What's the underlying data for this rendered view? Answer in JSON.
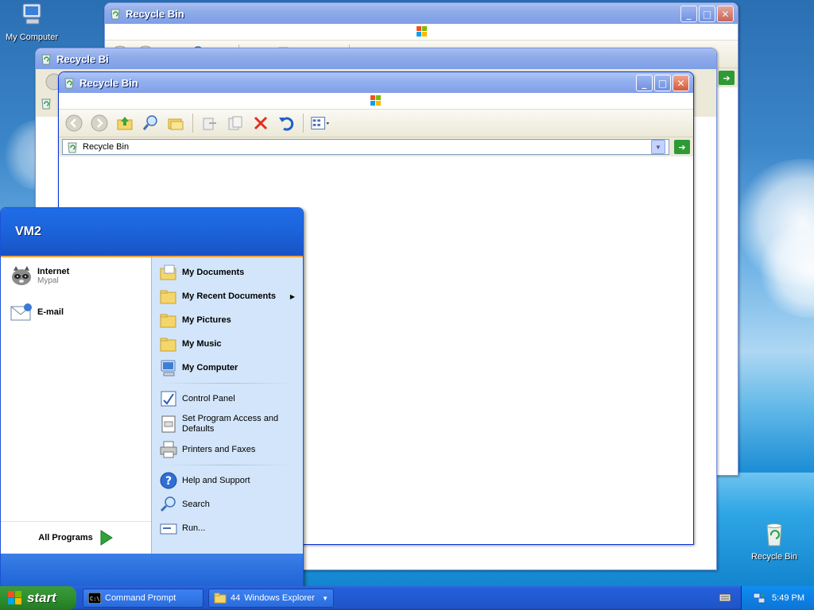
{
  "desktop": {
    "icons": [
      {
        "label": "My Computer"
      },
      {
        "label": "Recycle Bin"
      }
    ]
  },
  "windows": {
    "back": {
      "title": "Recycle Bin"
    },
    "middle": {
      "title": "Recycle Bi"
    },
    "front": {
      "title": "Recycle Bin",
      "address": "Recycle Bin"
    }
  },
  "start_menu": {
    "user": "VM2",
    "pinned": [
      {
        "label": "Internet",
        "sub": "Mypal"
      },
      {
        "label": "E-mail"
      }
    ],
    "all_programs": "All Programs",
    "right": {
      "my_documents": "My Documents",
      "my_recent_documents": "My Recent Documents",
      "my_pictures": "My Pictures",
      "my_music": "My Music",
      "my_computer": "My Computer",
      "control_panel": "Control Panel",
      "set_program_access_1": "Set Program Access and",
      "set_program_access_2": "Defaults",
      "printers": "Printers and Faxes",
      "help": "Help and Support",
      "search": "Search",
      "run": "Run..."
    }
  },
  "taskbar": {
    "start": "start",
    "buttons": [
      {
        "label": "Command Prompt"
      },
      {
        "count": "44",
        "label": "Windows Explorer"
      }
    ],
    "clock": "5:49 PM"
  }
}
